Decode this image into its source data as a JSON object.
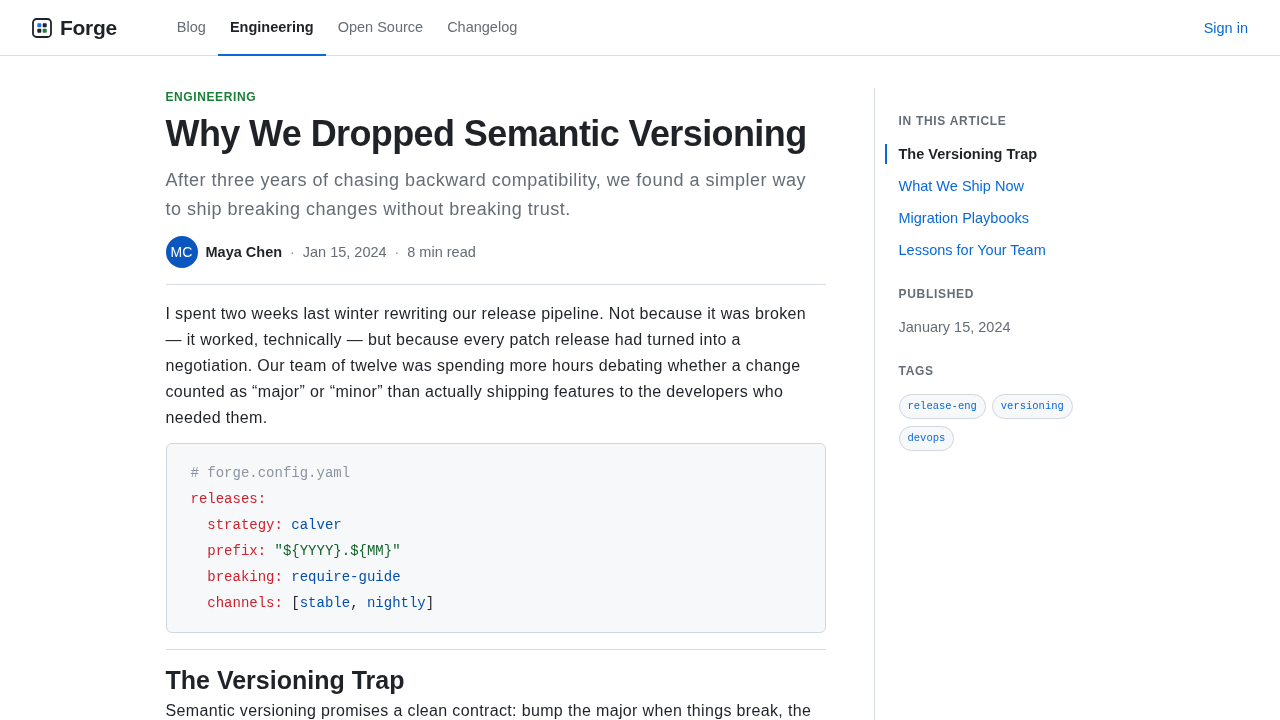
{
  "header": {
    "logo": "Forge",
    "nav": [
      {
        "label": "Blog",
        "selected": false
      },
      {
        "label": "Engineering",
        "selected": true
      },
      {
        "label": "Open Source",
        "selected": false
      },
      {
        "label": "Changelog",
        "selected": false
      }
    ],
    "sign_in": "Sign in"
  },
  "article": {
    "category": "ENGINEERING",
    "title": "Why We Dropped Semantic Versioning",
    "subtitle": "After three years of chasing backward compatibility, we found a simpler way to ship breaking changes without breaking trust.",
    "byline": {
      "avatar": "MC",
      "name": "Maya Chen",
      "meta": [
        {
          "separator": "·",
          "text": "Jan 15, 2024"
        },
        {
          "separator": "·",
          "text": "8 min read"
        }
      ]
    },
    "body": [
      {
        "kind": "paragraph",
        "text": "I spent two weeks last winter rewriting our release pipeline. Not because it was broken — it worked, technically — but because every patch release had turned into a negotiation. Our team of twelve was spending more hours debating whether a change counted as “major” or “minor” than actually shipping features to the developers who needed them."
      },
      {
        "kind": "code",
        "lines": [
          {
            "tokens": [
              {
                "kind": "comment",
                "text": "# forge.config.yaml"
              }
            ]
          },
          {
            "tokens": [
              {
                "kind": "key",
                "text": "releases:"
              }
            ],
            "children": [
              {
                "tokens": [
                  {
                    "kind": "key",
                    "text": "strategy: "
                  },
                  {
                    "kind": "value",
                    "text": "calver"
                  }
                ]
              },
              {
                "tokens": [
                  {
                    "kind": "key",
                    "text": "prefix: "
                  },
                  {
                    "kind": "string",
                    "text": "\"${YYYY}.${MM}\""
                  }
                ]
              },
              {
                "tokens": [
                  {
                    "kind": "key",
                    "text": "breaking: "
                  },
                  {
                    "kind": "value",
                    "text": "require-guide"
                  }
                ]
              },
              {
                "tokens": [
                  {
                    "kind": "key",
                    "text": "channels: "
                  },
                  {
                    "kind": "punct",
                    "text": "["
                  },
                  {
                    "kind": "value",
                    "text": "stable"
                  },
                  {
                    "kind": "punct",
                    "text": ", "
                  },
                  {
                    "kind": "value",
                    "text": "nightly"
                  },
                  {
                    "kind": "punct",
                    "text": "]"
                  }
                ]
              }
            ]
          }
        ]
      },
      {
        "kind": "heading",
        "text": "The Versioning Trap"
      },
      {
        "kind": "paragraph",
        "text": "Semantic versioning promises a clean contract: bump the major when things break, the"
      }
    ]
  },
  "sidebar": {
    "toc": {
      "title": "IN THIS ARTICLE",
      "items": [
        {
          "label": "The Versioning Trap",
          "selected": true
        },
        {
          "label": "What We Ship Now",
          "selected": false
        },
        {
          "label": "Migration Playbooks",
          "selected": false
        },
        {
          "label": "Lessons for Your Team",
          "selected": false
        }
      ]
    },
    "published": {
      "title": "PUBLISHED",
      "date": "January 15, 2024"
    },
    "tags": {
      "title": "TAGS",
      "items": [
        "release-eng",
        "versioning",
        "devops"
      ]
    }
  }
}
